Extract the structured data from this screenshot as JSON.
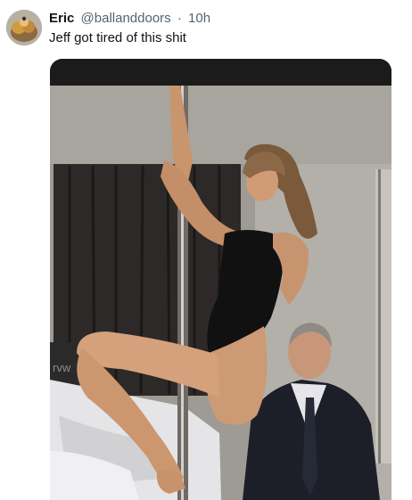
{
  "tweet": {
    "author": {
      "display_name": "Eric",
      "handle": "@ballanddoors",
      "avatar_icon": "avatar-image"
    },
    "separator": "·",
    "timestamp": "10h",
    "text": "Jeff got tired of this shit",
    "media": {
      "icon": "photo-image",
      "sign_text": "rvw"
    }
  },
  "colors": {
    "text_primary": "#0f1419",
    "text_secondary": "#536471",
    "background": "#ffffff"
  }
}
